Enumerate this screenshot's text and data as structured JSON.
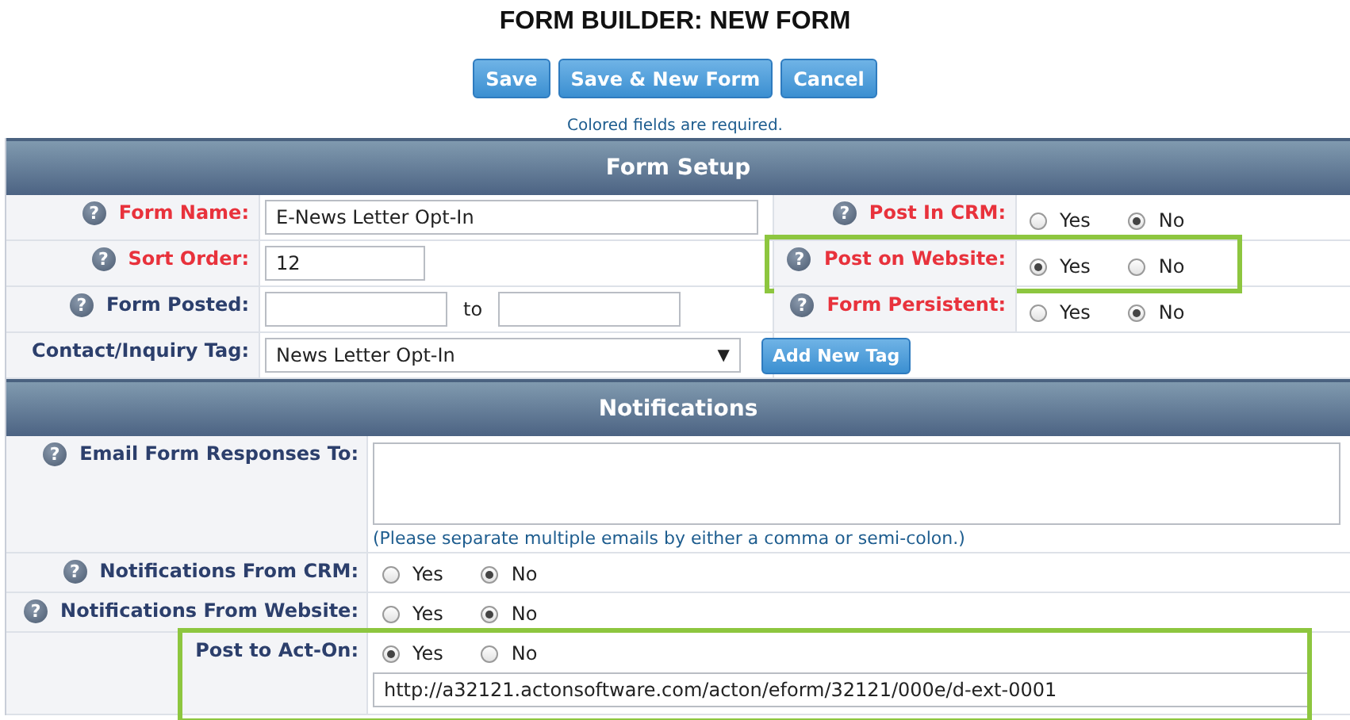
{
  "title": "FORM BUILDER: NEW FORM",
  "buttons": [
    "Save",
    "Save & New Form",
    "Cancel"
  ],
  "required_note": "Colored fields are required.",
  "form_setup": {
    "title": "Form Setup",
    "rows": [
      {
        "left": {
          "kind": "text",
          "label": "Form Name:",
          "required": true,
          "help": "?",
          "value": "E-News Letter Opt-In"
        },
        "right": {
          "kind": "radio",
          "label": "Post In CRM:",
          "required": true,
          "help": "?",
          "highlighted": false,
          "options": [
            {
              "label": "Yes",
              "selected": false
            },
            {
              "label": "No",
              "selected": true
            }
          ]
        }
      },
      {
        "left": {
          "kind": "number",
          "label": "Sort Order:",
          "required": true,
          "help": "?",
          "value": "12"
        },
        "right": {
          "kind": "radio",
          "label": "Post on Website:",
          "required": true,
          "help": "?",
          "highlighted": true,
          "options": [
            {
              "label": "Yes",
              "selected": true
            },
            {
              "label": "No",
              "selected": false
            }
          ]
        }
      },
      {
        "left": {
          "kind": "date_range",
          "label": "Form Posted:",
          "required": false,
          "help": "?",
          "separator": "to"
        },
        "right": {
          "kind": "radio",
          "label": "Form Persistent:",
          "required": true,
          "help": "?",
          "highlighted": false,
          "options": [
            {
              "label": "Yes",
              "selected": false
            },
            {
              "label": "No",
              "selected": true
            }
          ]
        }
      },
      {
        "left": {
          "kind": "select",
          "label": "Contact/Inquiry Tag:",
          "required": false,
          "value": "News Letter Opt-In",
          "arrow": "▼"
        },
        "right": {
          "kind": "button",
          "label": "Add New Tag"
        }
      }
    ]
  },
  "notifications": {
    "title": "Notifications",
    "rows": [
      {
        "kind": "textarea",
        "label": "Email Form Responses To:",
        "help": "?",
        "highlighted": false,
        "hint": "(Please separate multiple emails by either a comma or semi-colon.)"
      },
      {
        "kind": "radio",
        "label": "Notifications From CRM:",
        "help": "?",
        "highlighted": false,
        "options": [
          {
            "label": "Yes",
            "selected": false
          },
          {
            "label": "No",
            "selected": true
          }
        ]
      },
      {
        "kind": "radio",
        "label": "Notifications From Website:",
        "help": "?",
        "highlighted": false,
        "options": [
          {
            "label": "Yes",
            "selected": false
          },
          {
            "label": "No",
            "selected": true
          }
        ]
      },
      {
        "kind": "radio_url",
        "label": "Post to Act-On:",
        "highlighted": true,
        "options": [
          {
            "label": "Yes",
            "selected": true
          },
          {
            "label": "No",
            "selected": false
          }
        ],
        "url": "http://a32121.actonsoftware.com/acton/eform/32121/000e/d-ext-0001"
      }
    ]
  }
}
